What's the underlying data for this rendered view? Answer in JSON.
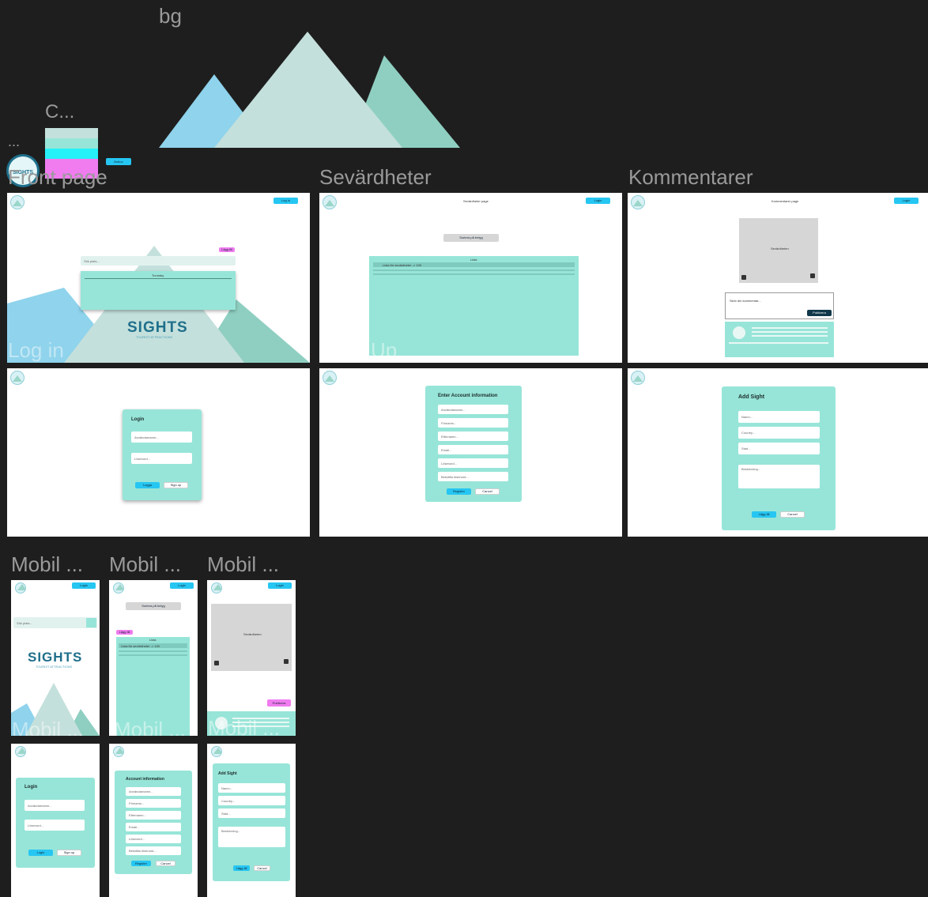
{
  "canvas": {
    "labels": {
      "bg": "bg",
      "c": "C...",
      "dots": "...",
      "front": "Front page",
      "sev": "Sevärdheter",
      "komm": "Kommentarer",
      "m1": "Mobil ...",
      "m2": "Mobil ...",
      "m3": "Mobil ..."
    },
    "ghost": {
      "login": "Log in",
      "signup": "Up",
      "mob1": "Mobil ...",
      "mob2": "Mobil ...",
      "mob3": "Mobil ..."
    },
    "components": {
      "btn": "Button"
    }
  },
  "brand": {
    "name": "SIGHTS",
    "tagline": "TOURIST ATTRACTIONS",
    "logo_text": "SIGHTS"
  },
  "front": {
    "login": "Log in",
    "search_ph": "Sök plats...",
    "result": "Tunnsby",
    "add": "Lägg till"
  },
  "sev": {
    "page_title": "Sevärdheter page",
    "login": "Login",
    "filter": "Sortera på betyg",
    "list_head": "Lista",
    "row1": "Lista för sevärdheter  ->  100"
  },
  "komm": {
    "page_title": "Kommentarer page",
    "login": "Login",
    "image": "Sevärdheten",
    "comment_ph": "Skriv din kommentar...",
    "publish": "Publicera"
  },
  "loginform": {
    "title": "Login",
    "user": "Användarnamn...",
    "pass": "Lösenord...",
    "login": "Logga",
    "signup": "Sign up"
  },
  "signup": {
    "title": "Enter Account information",
    "fields": [
      "Användarnamn...",
      "Förnamn...",
      "Efternamn...",
      "Email...",
      "Lösenord...",
      "Bekräfta lösenord..."
    ],
    "register": "Register",
    "cancel": "Cancel"
  },
  "addsight": {
    "title": "Add Sight",
    "name": "Namn...",
    "country": "Country...",
    "city": "Stad...",
    "desc": "Beskrivning...",
    "add": "Lägg till",
    "cancel": "Cancel"
  },
  "mobile": {
    "login_btn": "Login",
    "search_ph": "Sök plats...",
    "filter": "Sortera på betyg",
    "add": "Lägg till",
    "list_head": "Lista",
    "row1": "Lista för sevärdheter  ->  100",
    "image": "Sevärdheten",
    "publish": "Publicera",
    "loginform": {
      "title": "Login",
      "user": "Användarnamn...",
      "pass": "Lösenord...",
      "login": "Login",
      "signup": "Sign up"
    },
    "account": {
      "title": "Account information",
      "fields": [
        "Användarnamn...",
        "Förnamn...",
        "Efternamn...",
        "Email...",
        "Lösenord...",
        "Bekräfta lösenord..."
      ],
      "register": "Register",
      "cancel": "Cancel"
    },
    "addsight": {
      "title": "Add Sight",
      "name": "Namn...",
      "country": "Country...",
      "city": "Stad...",
      "desc": "Beskrivning...",
      "add": "Lägg till",
      "cancel": "Cancel"
    }
  },
  "colors": {
    "canvas": "#1e1e1e",
    "teal": "#97e5d8",
    "cyan": "#26c6f2",
    "pink": "#f07cf0",
    "sky": "#8fd3ec",
    "mint": "#c4e0dc",
    "green": "#8fcfc1"
  }
}
